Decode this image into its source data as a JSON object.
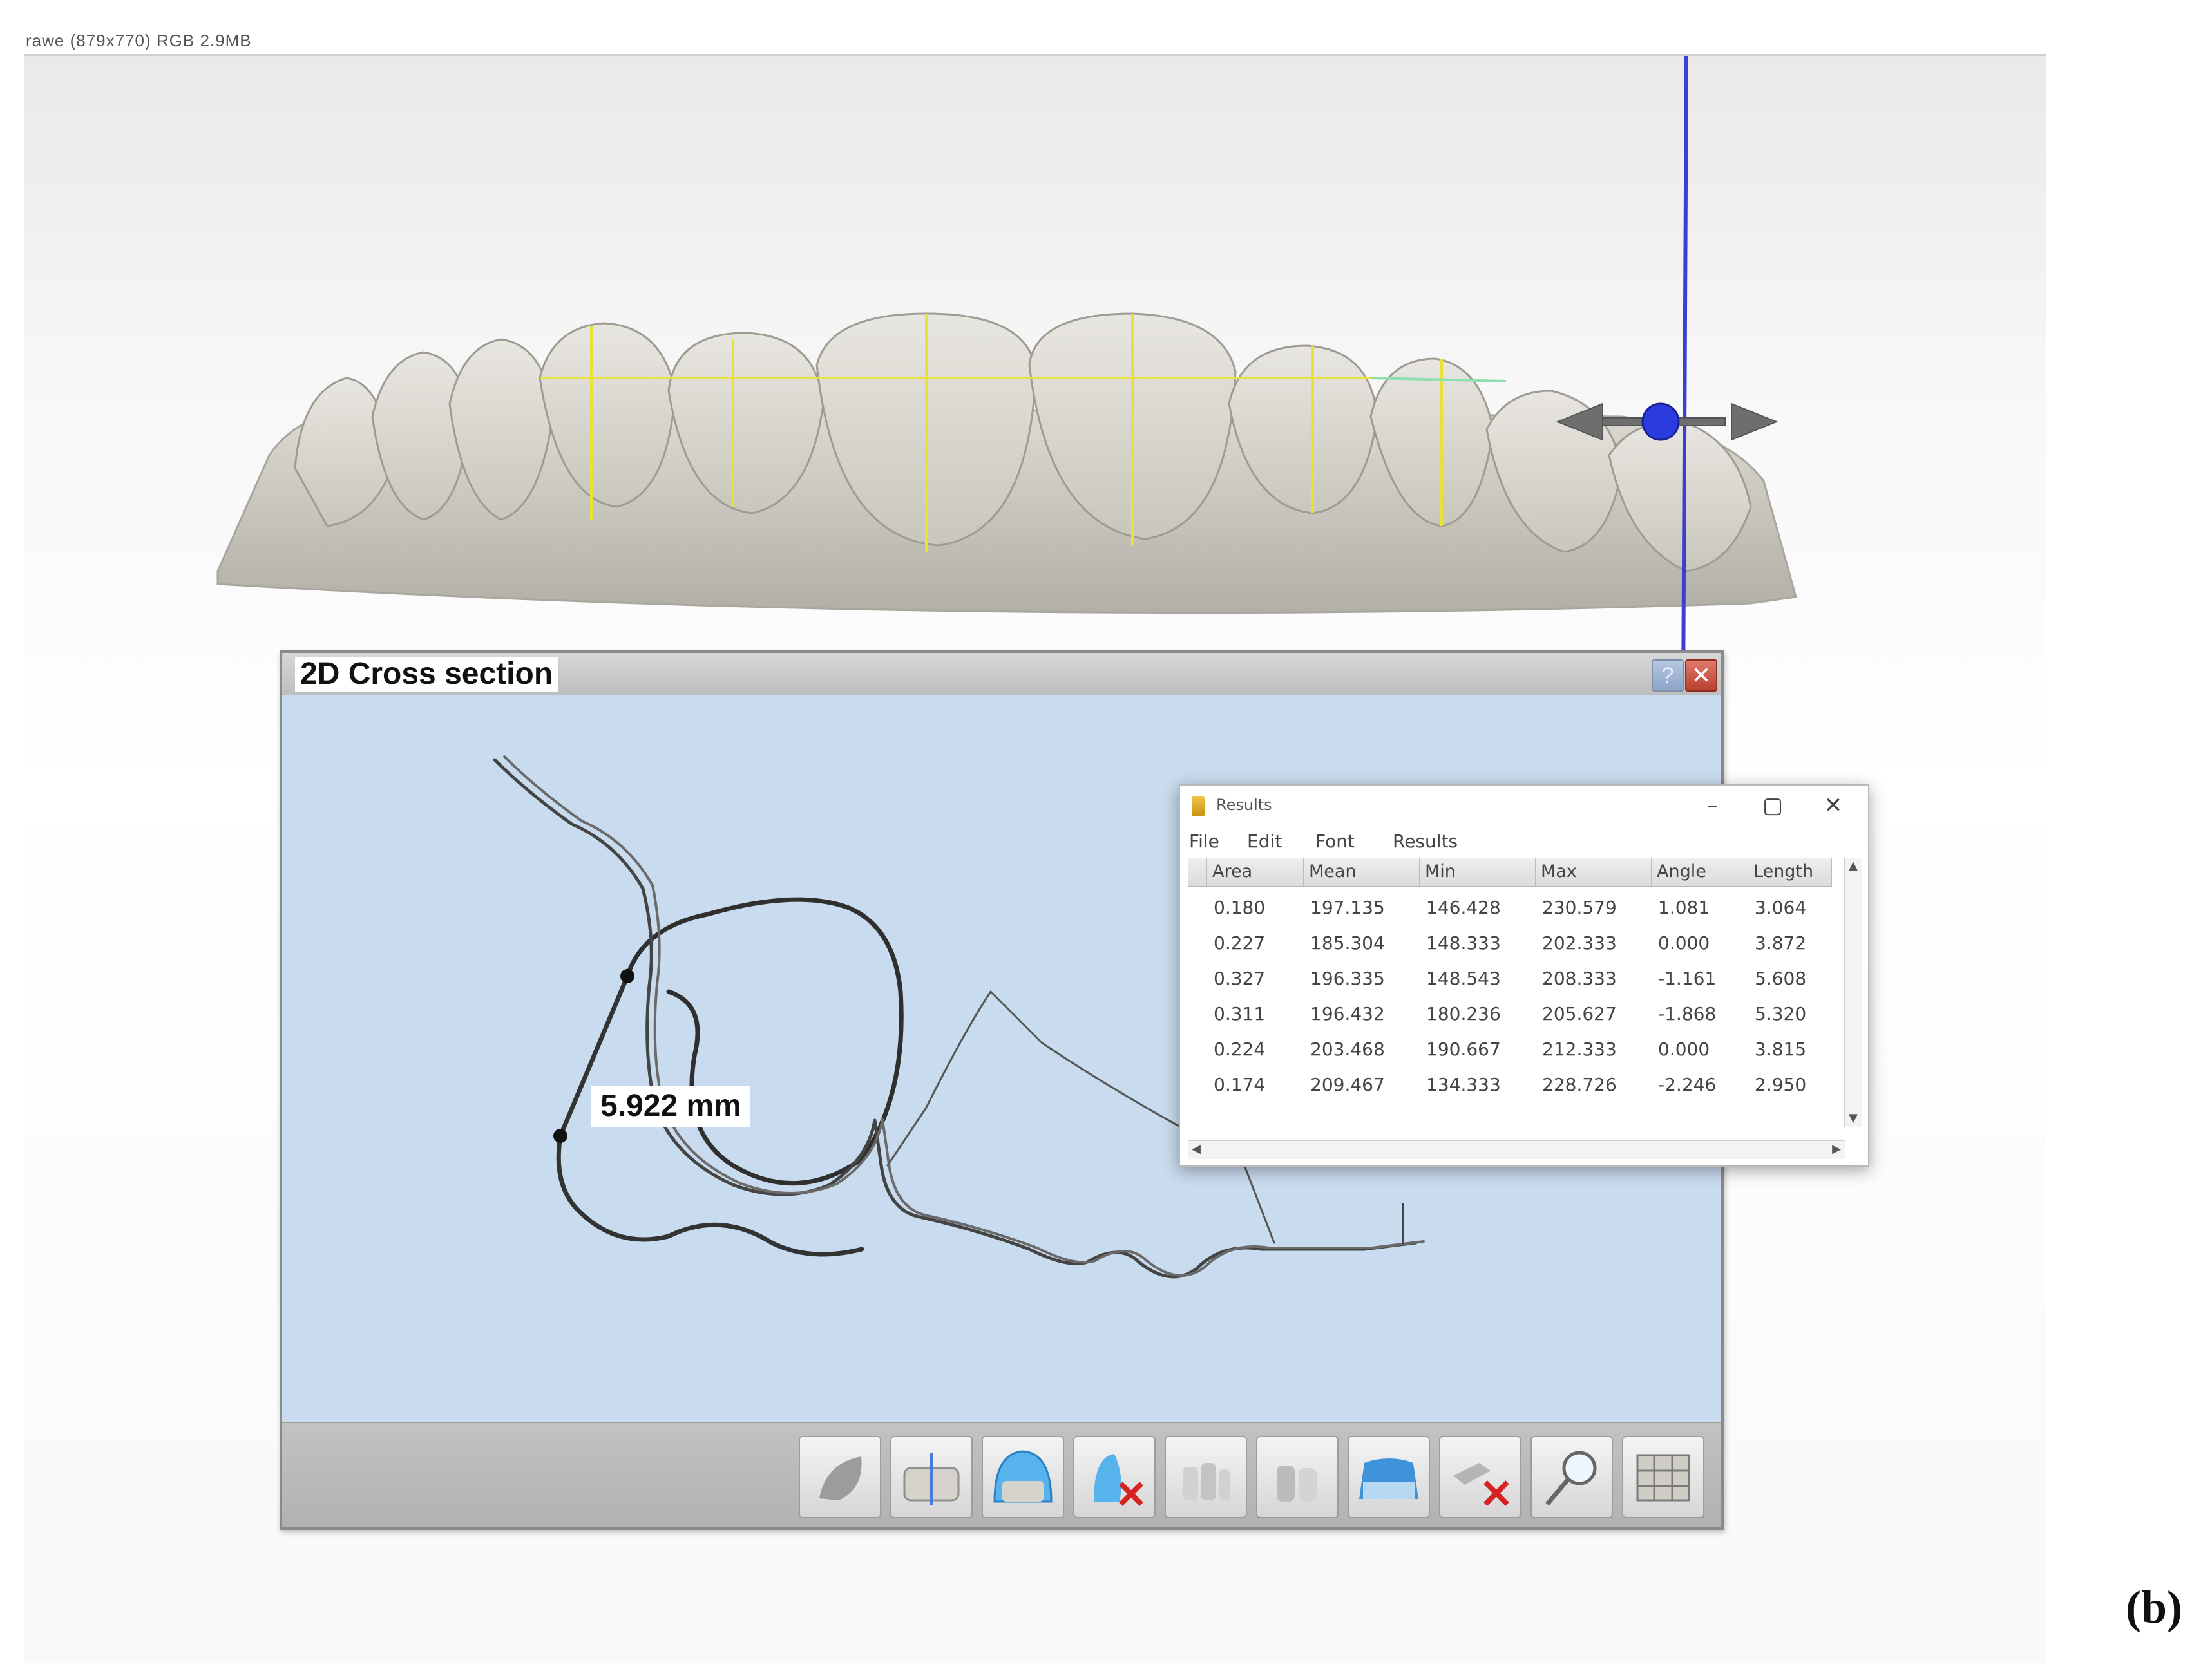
{
  "window": {
    "caption": "rawe (879x770) RGB 2.9MB"
  },
  "panel_label": "(b)",
  "cross_section": {
    "title": "2D Cross section",
    "measurement": "5.922 mm",
    "help_icon": "question-icon",
    "close_icon": "close-icon",
    "toolbar": [
      {
        "name": "tool-model-icon"
      },
      {
        "name": "tool-teeth-axis-icon"
      },
      {
        "name": "tool-arch-shell-icon"
      },
      {
        "name": "tool-remove-tooth-icon"
      },
      {
        "name": "tool-teeth-grey-icon"
      },
      {
        "name": "tool-teeth-pair-icon"
      },
      {
        "name": "tool-blue-block-icon"
      },
      {
        "name": "tool-delete-measure-icon"
      },
      {
        "name": "tool-magnifier-icon"
      },
      {
        "name": "tool-teeth-grid-icon"
      }
    ]
  },
  "results": {
    "title": "Results",
    "menu": [
      "File",
      "Edit",
      "Font",
      "Results"
    ],
    "columns": [
      "Area",
      "Mean",
      "Min",
      "Max",
      "Angle",
      "Length"
    ],
    "rows": [
      [
        "0.180",
        "197.135",
        "146.428",
        "230.579",
        "1.081",
        "3.064"
      ],
      [
        "0.227",
        "185.304",
        "148.333",
        "202.333",
        "0.000",
        "3.872"
      ],
      [
        "0.327",
        "196.335",
        "148.543",
        "208.333",
        "-1.161",
        "5.608"
      ],
      [
        "0.311",
        "196.432",
        "180.236",
        "205.627",
        "-1.868",
        "5.320"
      ],
      [
        "0.224",
        "203.468",
        "190.667",
        "212.333",
        "0.000",
        "3.815"
      ],
      [
        "0.174",
        "209.467",
        "134.333",
        "228.726",
        "-2.246",
        "2.950"
      ]
    ],
    "controls": {
      "minimize": "–",
      "maximize": "▢",
      "close": "✕"
    }
  },
  "colors": {
    "axis_blue": "#3a3fd0",
    "guide_yellow": "#e6e23a",
    "guide_green": "#8fe0b0",
    "canvas_blue": "#c9dbee"
  }
}
